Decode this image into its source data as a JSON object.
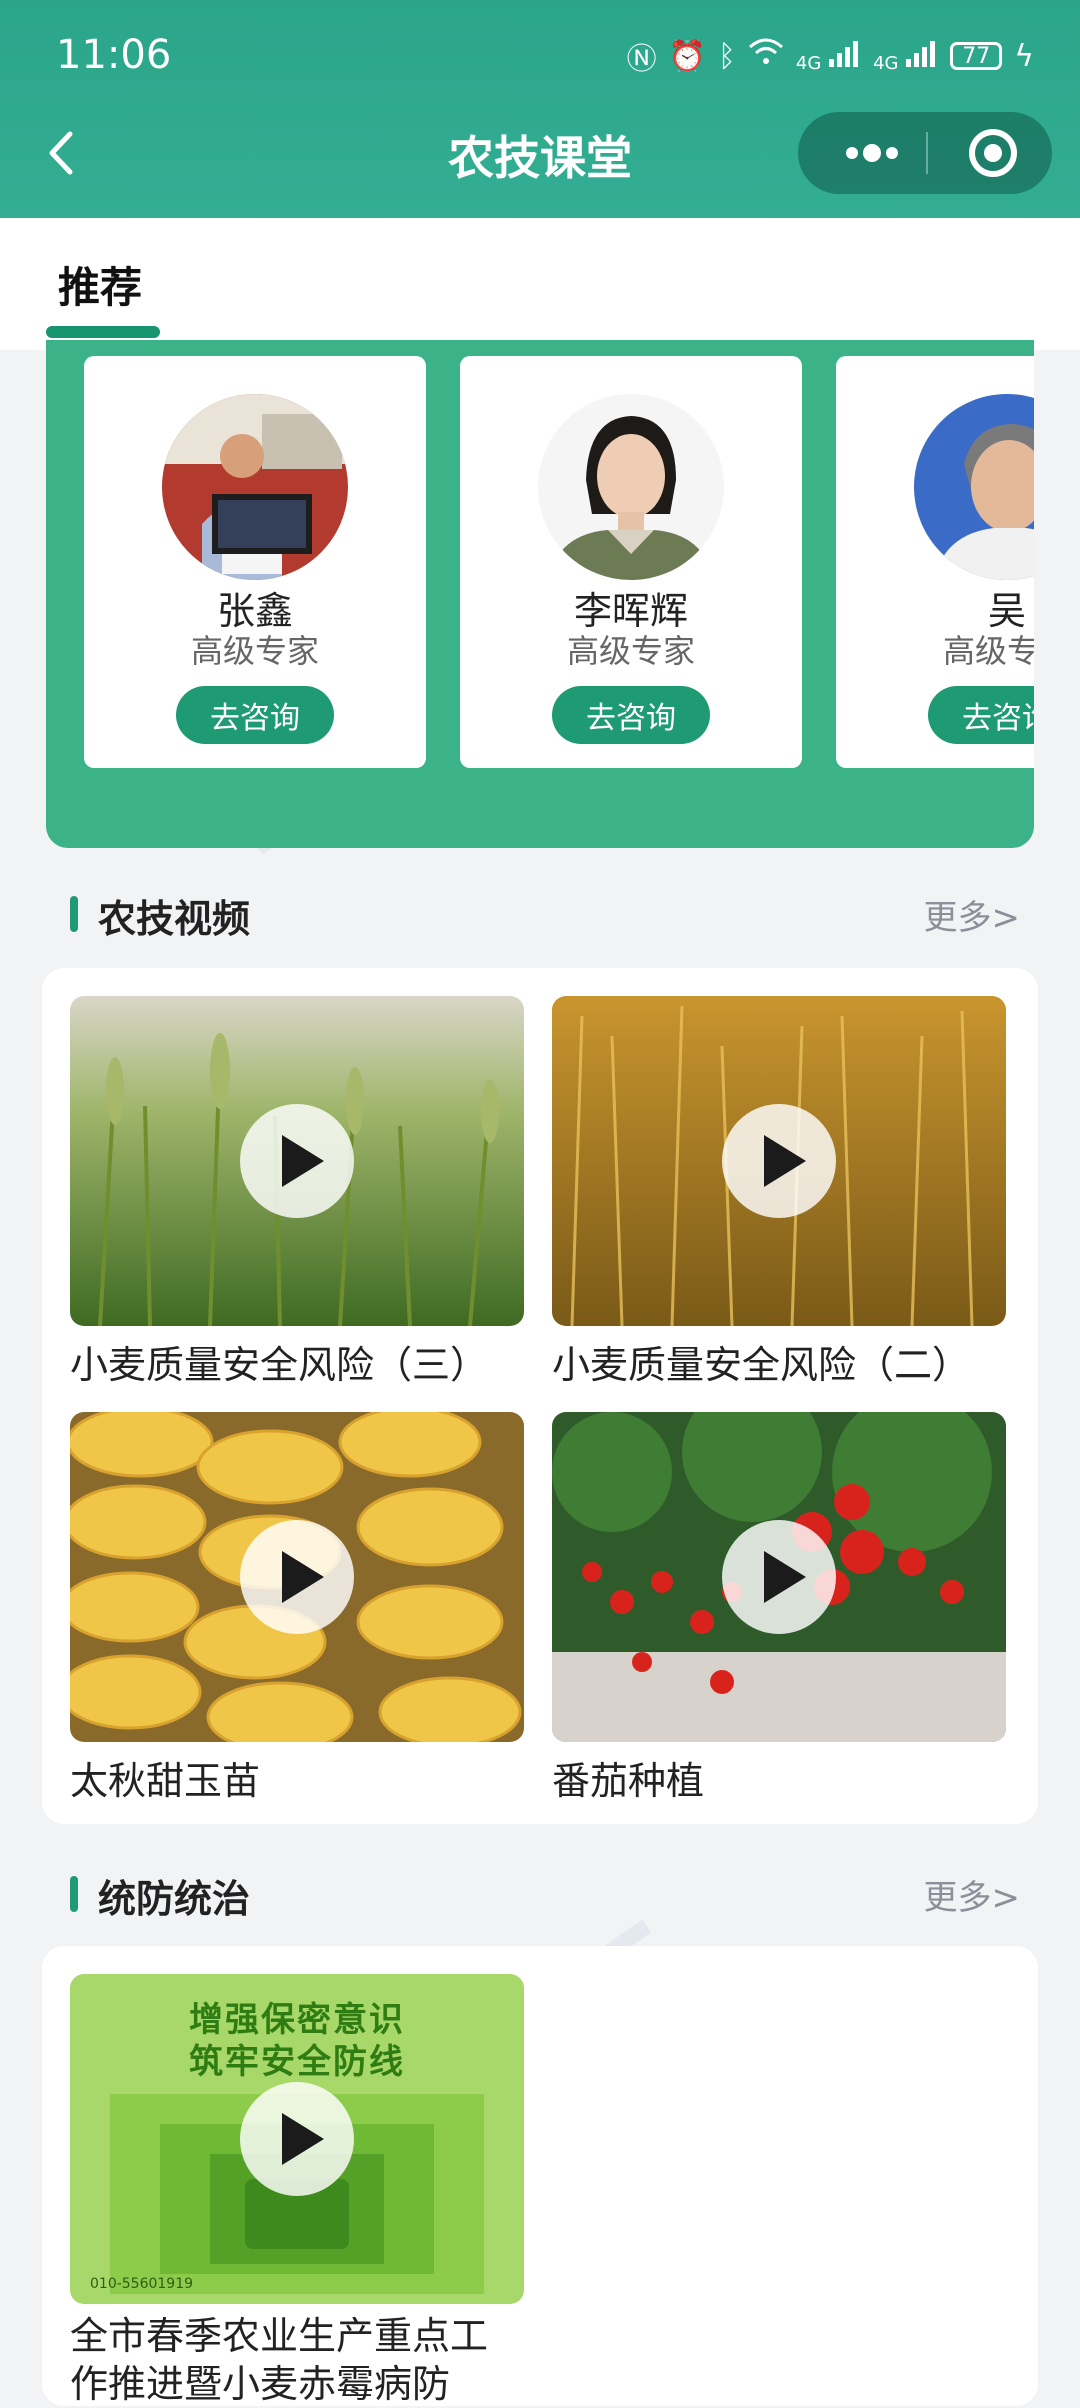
{
  "status_bar": {
    "time": "11:06",
    "battery": "77",
    "network_left": "4G",
    "network_right": "4G"
  },
  "nav": {
    "title": "农技课堂"
  },
  "tabs": [
    {
      "label": "推荐"
    }
  ],
  "experts": [
    {
      "name": "张鑫",
      "title": "高级专家",
      "button": "去咨询"
    },
    {
      "name": "李晖辉",
      "title": "高级专家",
      "button": "去咨询"
    },
    {
      "name": "吴",
      "title": "高级专家",
      "button": "去咨询"
    }
  ],
  "section_videos": {
    "title": "农技视频",
    "more": "更多>"
  },
  "videos": [
    {
      "title": "小麦质量安全风险（三）",
      "thumb": "green-wheat"
    },
    {
      "title": "小麦质量安全风险（二）",
      "thumb": "golden-wheat"
    },
    {
      "title": "太秋甜玉苗",
      "thumb": "persimmons"
    },
    {
      "title": "番茄种植",
      "thumb": "tomatoes"
    }
  ],
  "section_control": {
    "title": "统防统治",
    "more": "更多>"
  },
  "control_videos": [
    {
      "title": "全市春季农业生产重点工作推进暨小麦赤霉病防",
      "poster_line1": "增强保密意识",
      "poster_line2": "筑牢安全防线",
      "poster_phone": "010-55601919"
    }
  ],
  "colors": {
    "header": "#2aa58a",
    "accent": "#1f9b73",
    "panel": "#3bb287"
  }
}
